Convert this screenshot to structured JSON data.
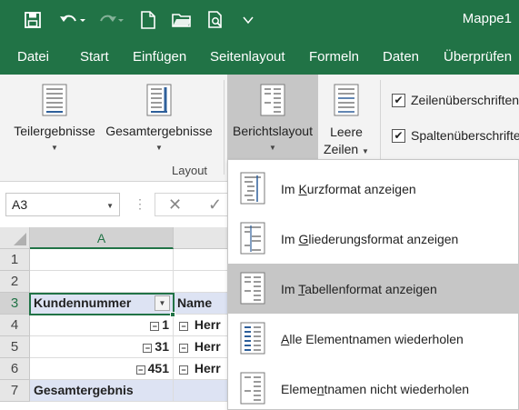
{
  "app_title": "Mappe1",
  "tabs": [
    "Datei",
    "Start",
    "Einfügen",
    "Seitenlayout",
    "Formeln",
    "Daten",
    "Überprüfen"
  ],
  "ribbon": {
    "teilergebnisse": "Teilergebnisse",
    "gesamtergebnisse": "Gesamtergebnisse",
    "berichtslayout": "Berichtslayout",
    "leere_zeilen_1": "Leere",
    "leere_zeilen_2": "Zeilen",
    "group_label": "Layout",
    "checkboxes": [
      "Zeilenüberschriften",
      "Spaltenüberschriften"
    ]
  },
  "namebox": "A3",
  "columns": [
    "A"
  ],
  "rows": [
    "1",
    "2",
    "3",
    "4",
    "5",
    "6",
    "7"
  ],
  "cells": {
    "a3": "Kundennummer",
    "b3": "Name",
    "a4": "1",
    "a5": "31",
    "a6": "451",
    "b4": "Herr",
    "b5": "Herr",
    "b6": "Herr",
    "a7": "Gesamtergebnis"
  },
  "menu": [
    {
      "pre": "Im ",
      "key": "K",
      "post": "urzformat anzeigen"
    },
    {
      "pre": "Im ",
      "key": "G",
      "post": "liederungsformat anzeigen"
    },
    {
      "pre": "Im ",
      "key": "T",
      "post": "abellenformat anzeigen"
    },
    {
      "pre": "",
      "key": "A",
      "post": "lle Elementnamen wiederholen"
    },
    {
      "pre": "Eleme",
      "key": "n",
      "post": "tnamen nicht wiederholen"
    }
  ],
  "colors": {
    "excel_green": "#217346",
    "header_blue": "#dde3f3",
    "hover_gray": "#c6c6c6"
  }
}
